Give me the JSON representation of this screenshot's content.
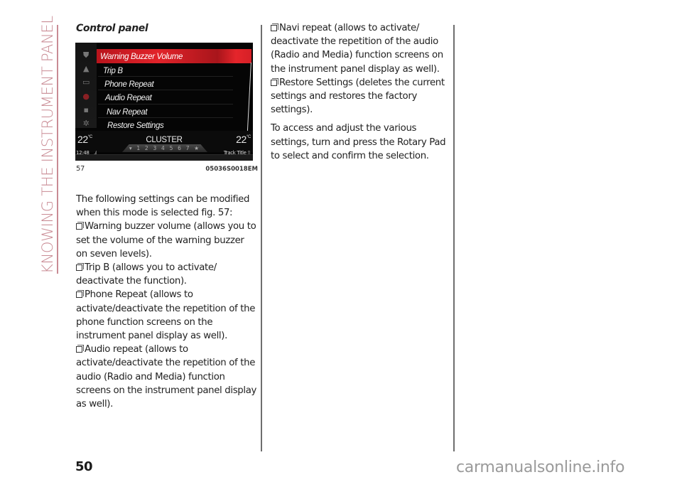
{
  "side_tab": {
    "label": "KNOWING THE INSTRUMENT PANEL",
    "color": "#c98b94"
  },
  "section": {
    "title": "Control panel"
  },
  "figure": {
    "number": "57",
    "code": "05036S0018EM",
    "screen": {
      "side_icons": [
        "shield-icon",
        "warning-triangle-icon",
        "phone-icon",
        "audio-disc-icon",
        "nav-screen-icon",
        "gear-icon"
      ],
      "menu_items": [
        {
          "label": "Warning Buzzer Volume",
          "selected": true
        },
        {
          "label": "Trip B",
          "selected": false
        },
        {
          "label": "Phone Repeat",
          "selected": false
        },
        {
          "label": "Audio Repeat",
          "selected": false
        },
        {
          "label": "Nav Repeat",
          "selected": false
        },
        {
          "label": "Restore Settings",
          "selected": false
        }
      ],
      "temp_left": "22",
      "temp_right": "22",
      "temp_unit": "°C",
      "mode_label": "CLUSTER",
      "clock": "12:48",
      "signal": "..ıl",
      "presets": "▾ 1 2 3 4 5 6 7 ★",
      "track_title": "Track Title",
      "track_icon": "▯",
      "accent_color": "#e2232a"
    }
  },
  "col1": {
    "intro": "The following settings can be modified when this mode is selected fig. 57:",
    "bullets": [
      "Warning buzzer volume (allows you to set the volume of the warning buzzer on seven levels).",
      "Trip B (allows you to activate/ deactivate the function).",
      "Phone Repeat (allows to activate/deactivate the repetition of the phone function screens on the instrument panel display as well).",
      "Audio repeat (allows to activate/deactivate the repetition of the audio (Radio and Media) function screens on the instrument panel display as well)."
    ]
  },
  "col2": {
    "bullets": [
      "Navi repeat (allows to activate/ deactivate the repetition of the audio (Radio and Media) function screens on the instrument panel display as well).",
      "Restore Settings (deletes the current settings and restores the factory settings)."
    ],
    "closing": "To access and adjust the various settings, turn and press the Rotary Pad to select and confirm the selection."
  },
  "footer": {
    "page_number": "50",
    "watermark": "carmanualsonline.info"
  }
}
